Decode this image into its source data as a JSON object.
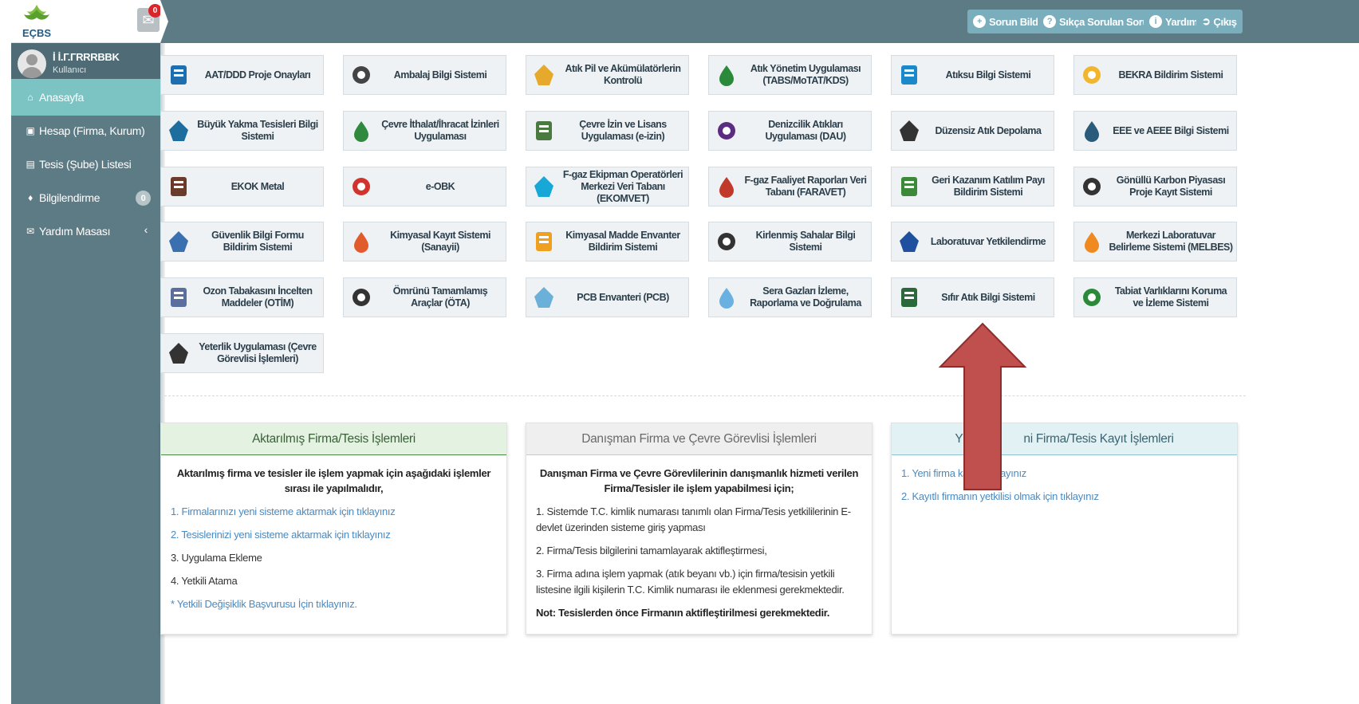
{
  "header": {
    "logo_text": "EÇBS",
    "mail_badge": "0",
    "buttons": [
      {
        "label": "Sorun Bildir",
        "icon": "plus-circle-icon"
      },
      {
        "label": "Sıkça Sorulan Sorular",
        "icon": "question-circle-icon"
      },
      {
        "label": "Yardım",
        "icon": "info-circle-icon"
      },
      {
        "label": "Çıkış",
        "icon": "sign-out-icon"
      }
    ]
  },
  "user": {
    "name": "İ İ.Г.ГRRRBBK",
    "role": "Kullanıcı"
  },
  "sidebar": {
    "items": [
      {
        "label": "Anasayfa",
        "icon": "home-icon"
      },
      {
        "label": "Hesap (Firma, Kurum)",
        "icon": "building-icon"
      },
      {
        "label": "Tesis (Şube) Listesi",
        "icon": "store-icon"
      },
      {
        "label": "Bilgilendirme",
        "icon": "bell-icon",
        "badge": "0"
      },
      {
        "label": "Yardım Masası",
        "icon": "envelope-icon"
      }
    ]
  },
  "tiles": [
    {
      "label": "AAT/DDD Proje Onayları",
      "icon": "project-docs-icon"
    },
    {
      "label": "Ambalaj Bilgi Sistemi",
      "icon": "package-icon"
    },
    {
      "label": "Atık Pil ve Akümülatörlerin Kontrolü",
      "icon": "battery-icon"
    },
    {
      "label": "Atık Yönetim Uygulaması (TABS/MoTAT/KDS)",
      "icon": "trash-bin-icon"
    },
    {
      "label": "Atıksu Bilgi Sistemi",
      "icon": "water-drop-icon"
    },
    {
      "label": "BEKRA Bildirim Sistemi",
      "icon": "warning-triangle-icon"
    },
    {
      "label": "Büyük Yakma Tesisleri Bilgi Sistemi",
      "icon": "factory-icon"
    },
    {
      "label": "Çevre İthalat/İhracat İzinleri Uygulaması",
      "icon": "import-export-icon"
    },
    {
      "label": "Çevre İzin ve Lisans Uygulaması (e-izin)",
      "icon": "license-doc-icon"
    },
    {
      "label": "Denizcilik Atıkları Uygulaması (DAU)",
      "icon": "ship-icon"
    },
    {
      "label": "Düzensiz Atık Depolama",
      "icon": "warehouse-icon"
    },
    {
      "label": "EEE ve AEEE Bilgi Sistemi",
      "icon": "electronics-icon"
    },
    {
      "label": "EKOK Metal",
      "icon": "metal-icon"
    },
    {
      "label": "e-OBK",
      "icon": "molecule-icon"
    },
    {
      "label": "F-gaz Ekipman Operatörleri Merkezi Veri Tabanı (EKOMVET)",
      "icon": "hexagon-icon"
    },
    {
      "label": "F-gaz Faaliyet Raporları Veri Tabanı (FARAVET)",
      "icon": "gas-cloud-icon"
    },
    {
      "label": "Geri Kazanım Katılım Payı Bildirim Sistemi",
      "icon": "recycle-icon"
    },
    {
      "label": "Gönüllü Karbon Piyasası Proje Kayıt Sistemi",
      "icon": "carbon-icon"
    },
    {
      "label": "Güvenlik Bilgi Formu Bildirim Sistemi",
      "icon": "safety-form-icon"
    },
    {
      "label": "Kimyasal Kayıt Sistemi (Sanayii)",
      "icon": "chemical-register-icon"
    },
    {
      "label": "Kimyasal Madde Envanter Bildirim Sistemi",
      "icon": "chemical-inventory-icon"
    },
    {
      "label": "Kirlenmiş Sahalar Bilgi Sistemi",
      "icon": "polluted-site-icon"
    },
    {
      "label": "Laboratuvar Yetkilendirme",
      "icon": "flask-icon"
    },
    {
      "label": "Merkezi Laboratuvar Belirleme Sistemi (MELBES)",
      "icon": "lab-center-icon"
    },
    {
      "label": "Ozon Tabakasını İncelten Maddeler (OTİM)",
      "icon": "ozone-icon"
    },
    {
      "label": "Ömrünü Tamamlamış Araçlar (ÖTA)",
      "icon": "car-icon"
    },
    {
      "label": "PCB Envanteri (PCB)",
      "icon": "pcb-wave-icon"
    },
    {
      "label": "Sera Gazları İzleme, Raporlama ve Doğrulama",
      "icon": "cloud-icon"
    },
    {
      "label": "Sıfır Atık Bilgi Sistemi",
      "icon": "zero-waste-icon"
    },
    {
      "label": "Tabiat Varlıklarını Koruma ve İzleme Sistemi",
      "icon": "plant-icon"
    },
    {
      "label": "Yeterlik Uygulaması (Çevre Görevlisi İşlemleri)",
      "icon": "certificate-doc-icon"
    }
  ],
  "panels": {
    "left": {
      "title": "Aktarılmış Firma/Tesis İşlemleri",
      "intro": "Aktarılmış firma ve tesisler ile işlem yapmak için aşağıdaki işlemler sırası ile yapılmalıdır,",
      "link1": "1. Firmalarınızı yeni sisteme aktarmak için tıklayınız",
      "link2": "2. Tesislerinizi yeni sisteme aktarmak için tıklayınız",
      "step3": "3. Uygulama Ekleme",
      "step4": "4. Yetkili Atama",
      "link5": "* Yetkili Değişiklik Başvurusu İçin tıklayınız."
    },
    "middle": {
      "title": "Danışman Firma ve Çevre Görevlisi İşlemleri",
      "intro": "Danışman Firma ve Çevre Görevlilerinin danışmanlık hizmeti verilen Firma/Tesisler ile işlem yapabilmesi için;",
      "line1": "1. Sistemde T.C. kimlik numarası tanımlı olan Firma/Tesis yetkililerinin E-devlet üzerinden sisteme giriş yapması",
      "line2": "2. Firma/Tesis bilgilerini tamamlayarak aktifleştirmesi,",
      "line3": "3. Firma adına işlem yapmak (atık beyanı vb.) için firma/tesisin yetkili listesine ilgili kişilerin T.C. Kimlik numarası ile eklenmesi gerekmektedir.",
      "note": "Not: Tesislerden önce Firmanın aktifleştirilmesi gerekmektedir."
    },
    "right": {
      "title_left": "Y",
      "title_right": "ni Firma/Tesis Kayıt İşlemleri",
      "link1_left": "1. Yeni firma ka",
      "link1_right": "ayınız",
      "link2": "2. Kayıtlı firmanın yetkilisi olmak için tıklayınız"
    }
  },
  "overlay": {
    "arrow_color": "#c0504d",
    "arrow_outline": "#8c2e2c"
  }
}
